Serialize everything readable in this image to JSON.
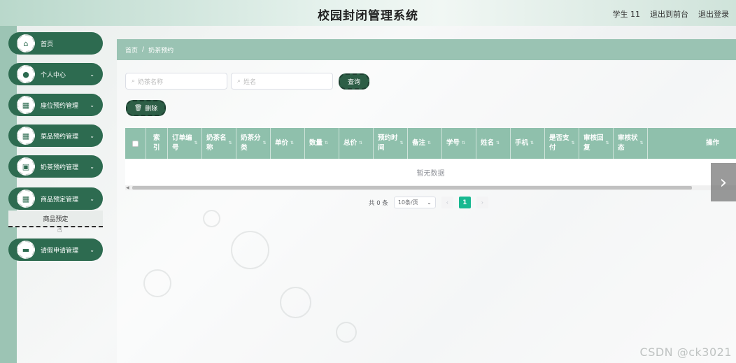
{
  "header": {
    "title": "校园封闭管理系统",
    "user": "学生 11",
    "frontend_link": "退出到前台",
    "logout": "退出登录"
  },
  "sidebar": {
    "items": [
      {
        "label": "首页",
        "icon": "home-icon",
        "glyph": "⌂",
        "chevron": ""
      },
      {
        "label": "个人中心",
        "icon": "user-icon",
        "glyph": "●",
        "chevron": "⌄"
      },
      {
        "label": "座位预约管理",
        "icon": "grid-icon",
        "glyph": "▦",
        "chevron": "⌄"
      },
      {
        "label": "菜品预约管理",
        "icon": "grid-icon",
        "glyph": "▦",
        "chevron": "⌄"
      },
      {
        "label": "奶茶预约管理",
        "icon": "clipboard-icon",
        "glyph": "▣",
        "chevron": "⌄"
      },
      {
        "label": "商品预定管理",
        "icon": "grid-icon",
        "glyph": "▦",
        "chevron": "⌄"
      },
      {
        "label": "请假申请管理",
        "icon": "monitor-icon",
        "glyph": "▬",
        "chevron": "⌄"
      }
    ],
    "submenu_item": "商品预定"
  },
  "breadcrumb": {
    "home": "首页",
    "separator": "/",
    "current": "奶茶预约"
  },
  "search": {
    "name_placeholder": "奶茶名称",
    "person_placeholder": "姓名",
    "search_button": "查询",
    "delete_button": "删除"
  },
  "table": {
    "columns": [
      {
        "line1": "索",
        "line2": "引"
      },
      {
        "line1": "订单编",
        "line2": "号"
      },
      {
        "line1": "奶茶名",
        "line2": "称"
      },
      {
        "line1": "奶茶分",
        "line2": "类"
      },
      {
        "line1": "单价",
        "line2": ""
      },
      {
        "line1": "数量",
        "line2": ""
      },
      {
        "line1": "总价",
        "line2": ""
      },
      {
        "line1": "预约时",
        "line2": "间"
      },
      {
        "line1": "备注",
        "line2": ""
      },
      {
        "line1": "学号",
        "line2": ""
      },
      {
        "line1": "姓名",
        "line2": ""
      },
      {
        "line1": "手机",
        "line2": ""
      },
      {
        "line1": "是否支",
        "line2": "付"
      },
      {
        "line1": "审核回",
        "line2": "复"
      },
      {
        "line1": "审核状",
        "line2": "态"
      }
    ],
    "actions_header": "操作",
    "empty_text": "暂无数据"
  },
  "pagination": {
    "total": "共 0 条",
    "page_size": "10条/页",
    "current_page": "1"
  },
  "watermark": "CSDN @ck3021",
  "colors": {
    "primary": "#2d6b50",
    "header_row": "#8fc0ac",
    "accent": "#17b890"
  }
}
